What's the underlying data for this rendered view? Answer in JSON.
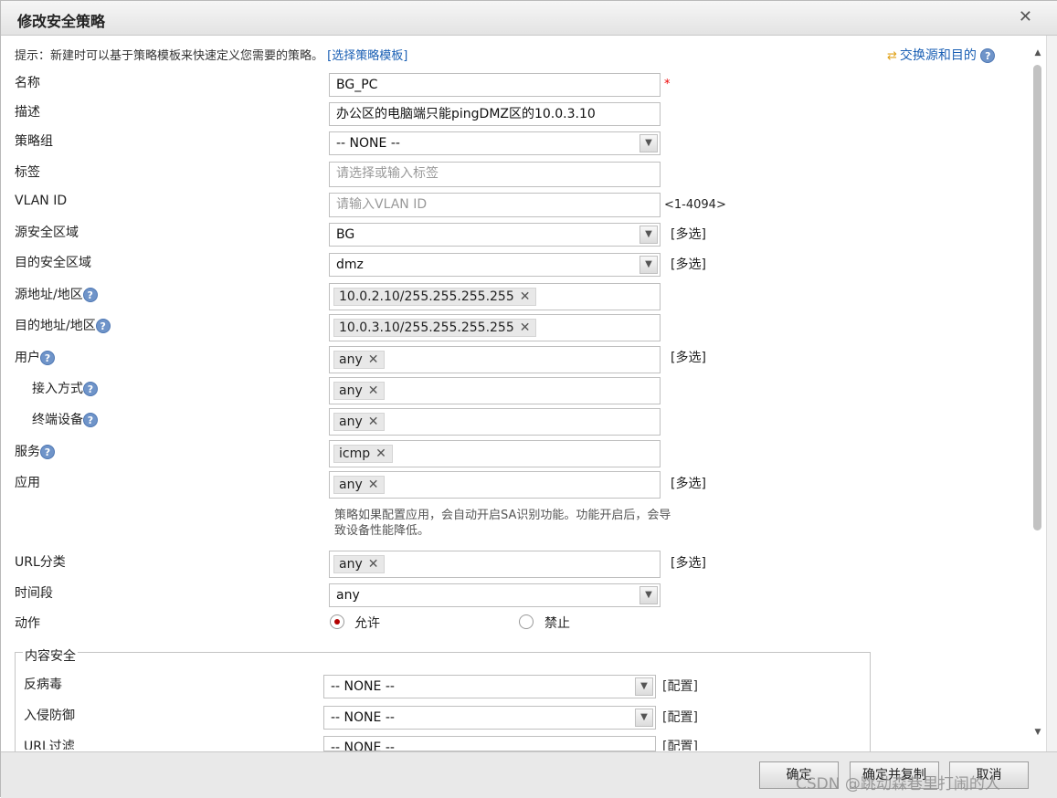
{
  "dialog": {
    "title": "修改安全策略",
    "close_glyph": "✕"
  },
  "hint": {
    "text": "提示：新建时可以基于策略模板来快速定义您需要的策略。",
    "link": "[选择策略模板]"
  },
  "swap": {
    "label": "交换源和目的",
    "icon": "swap-arrows-icon"
  },
  "help_glyph": "?",
  "multi_select": "[多选]",
  "config_link": "[配置]",
  "form": {
    "name": {
      "label": "名称",
      "value": "BG_PC",
      "required_mark": "*"
    },
    "description": {
      "label": "描述",
      "value": "办公区的电脑端只能pingDMZ区的10.0.3.10"
    },
    "policy_group": {
      "label": "策略组",
      "value": "-- NONE --"
    },
    "tag": {
      "label": "标签",
      "placeholder": "请选择或输入标签"
    },
    "vlan_id": {
      "label": "VLAN ID",
      "placeholder": "请输入VLAN ID",
      "range": "<1-4094>"
    },
    "src_zone": {
      "label": "源安全区域",
      "value": "BG"
    },
    "dst_zone": {
      "label": "目的安全区域",
      "value": "dmz"
    },
    "src_addr": {
      "label": "源地址/地区",
      "value": "10.0.2.10/255.255.255.255"
    },
    "dst_addr": {
      "label": "目的地址/地区",
      "value": "10.0.3.10/255.255.255.255"
    },
    "user": {
      "label": "用户",
      "value": "any"
    },
    "access_method": {
      "label": "接入方式",
      "value": "any"
    },
    "terminal_device": {
      "label": "终端设备",
      "value": "any"
    },
    "service": {
      "label": "服务",
      "value": "icmp"
    },
    "application": {
      "label": "应用",
      "value": "any",
      "note": "策略如果配置应用，会自动开启SA识别功能。功能开启后，会导致设备性能降低。"
    },
    "url_category": {
      "label": "URL分类",
      "value": "any"
    },
    "time_range": {
      "label": "时间段",
      "value": "any"
    },
    "action": {
      "label": "动作",
      "allow": "允许",
      "deny": "禁止",
      "selected": "允许"
    }
  },
  "content_security": {
    "legend": "内容安全",
    "antivirus": {
      "label": "反病毒",
      "value": "-- NONE --"
    },
    "ips": {
      "label": "入侵防御",
      "value": "-- NONE --"
    },
    "url_filter": {
      "label": "URL过滤",
      "value": "-- NONE --"
    }
  },
  "buttons": {
    "ok": "确定",
    "ok_copy": "确定并复制",
    "cancel": "取消"
  },
  "watermark": "CSDN @跳动森巷里打闹的人"
}
